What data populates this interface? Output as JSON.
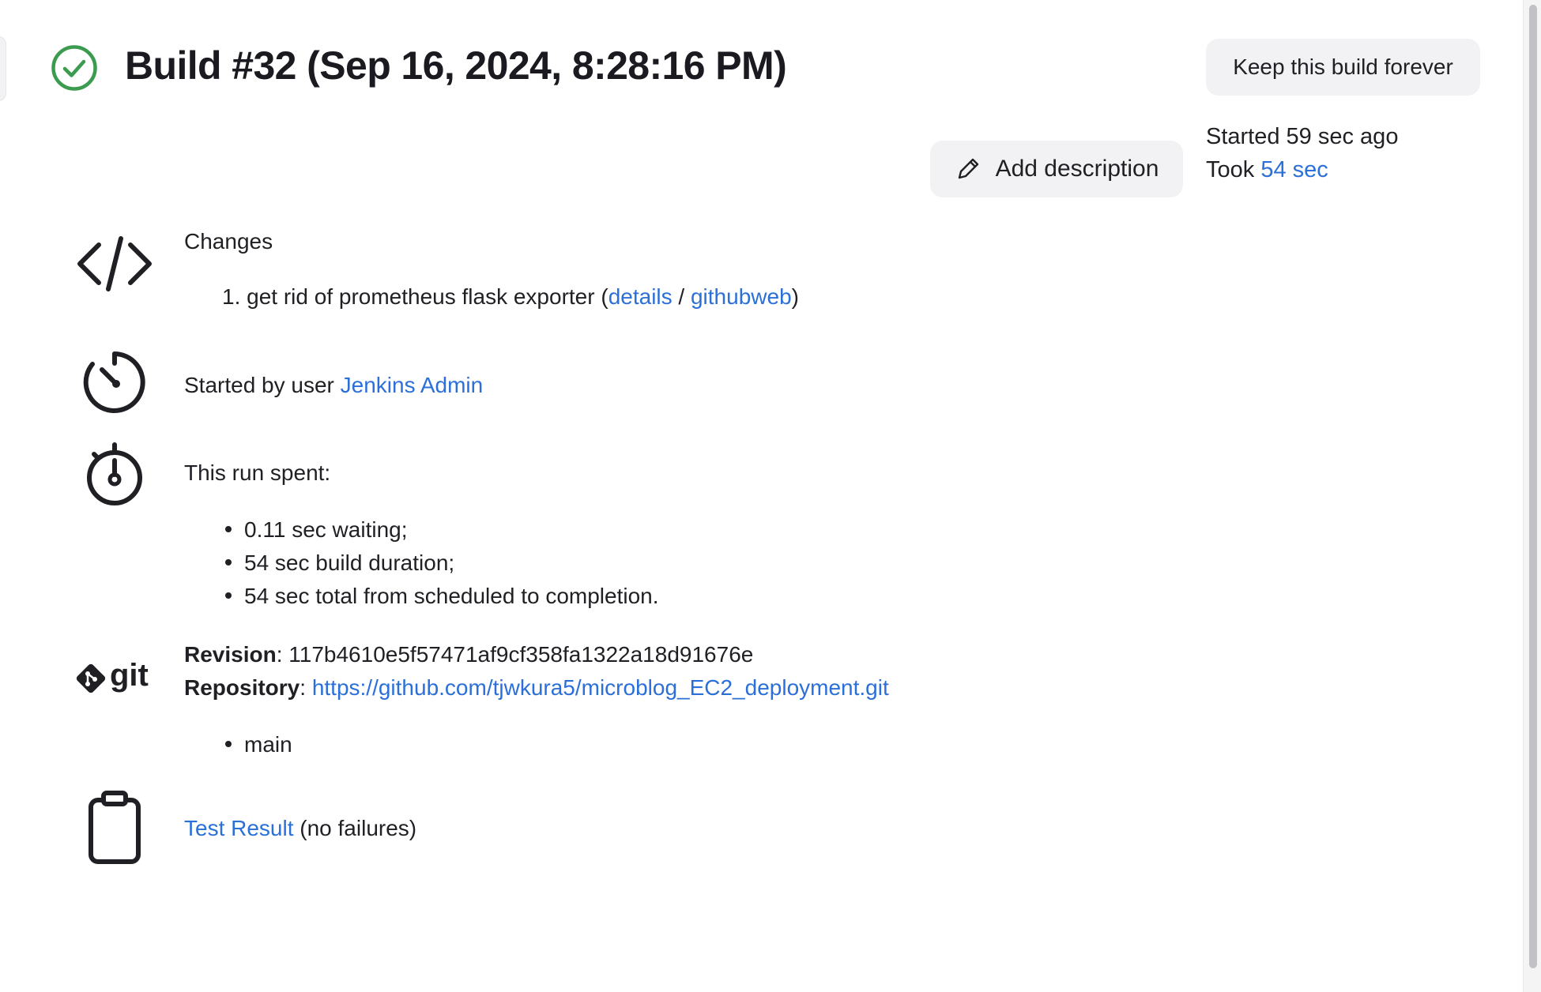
{
  "header": {
    "title": "Build #32 (Sep 16, 2024, 8:28:16 PM)",
    "status_icon": "success-check-icon",
    "keep_forever_label": "Keep this build forever",
    "add_description_label": "Add description"
  },
  "timing": {
    "started_text": "Started 59 sec ago",
    "took_prefix": "Took ",
    "took_link": "54 sec"
  },
  "changes": {
    "heading": "Changes",
    "items": [
      {
        "number": "1.",
        "message": "get rid of prometheus flask exporter",
        "open_paren": "(",
        "details_label": "details",
        "separator": " / ",
        "githubweb_label": "githubweb",
        "close_paren": ")"
      }
    ]
  },
  "cause": {
    "prefix": "Started by user ",
    "user_link": "Jenkins Admin"
  },
  "time_spent": {
    "heading": "This run spent:",
    "items": [
      "0.11 sec waiting;",
      "54 sec build duration;",
      "54 sec total from scheduled to completion."
    ]
  },
  "git": {
    "logo_text": "git",
    "revision_label": "Revision",
    "revision_value": "117b4610e5f57471af9cf358fa1322a18d91676e",
    "repository_label": "Repository",
    "repository_url": "https://github.com/tjwkura5/microblog_EC2_deployment.git",
    "branches": [
      "main"
    ]
  },
  "tests": {
    "link_label": "Test Result",
    "summary": "(no failures)"
  },
  "colors": {
    "link": "#2b6fd8",
    "success": "#3b9b4f",
    "button_bg": "#f2f2f4"
  }
}
